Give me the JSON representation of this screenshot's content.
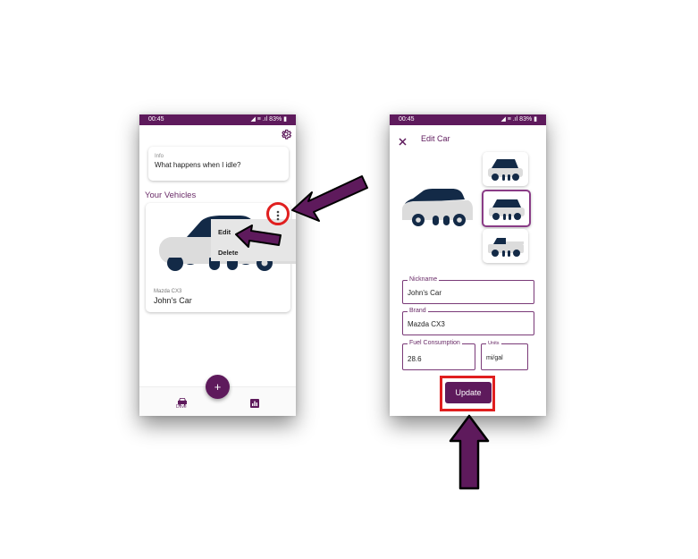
{
  "colors": {
    "brand": "#5e1a5c",
    "car_dark": "#132a47",
    "car_light": "#d8d8d8",
    "arrow": "#5e1a5c",
    "highlight_red": "#e01f1f"
  },
  "left_phone": {
    "status": {
      "time": "00:45",
      "icons": "◢ ≡ .ıl 83% ▮"
    },
    "settings_icon": "gear-icon",
    "info": {
      "label": "Info",
      "text": "What happens when I idle?"
    },
    "section_title": "Your Vehicles",
    "vehicle": {
      "brand": "Mazda CX3",
      "nickname": "John's Car"
    },
    "menu": {
      "items": [
        "Edit",
        "Delete"
      ]
    },
    "fab_label": "+",
    "bottom_nav": {
      "drive_label": "Drive",
      "stats_icon": "bar-chart-icon"
    }
  },
  "right_phone": {
    "status": {
      "time": "00:45",
      "icons": "◢ ≡ .ıl 83% ▮"
    },
    "title": "Edit Car",
    "close_icon": "close-icon",
    "fields": {
      "nickname": {
        "label": "Nickname",
        "value": "John's Car"
      },
      "brand": {
        "label": "Brand",
        "value": "Mazda CX3"
      },
      "fuel": {
        "label": "Fuel Consumption",
        "value": "28.6"
      },
      "units": {
        "label": "Units",
        "value": "mi/gal"
      }
    },
    "update_label": "Update"
  }
}
